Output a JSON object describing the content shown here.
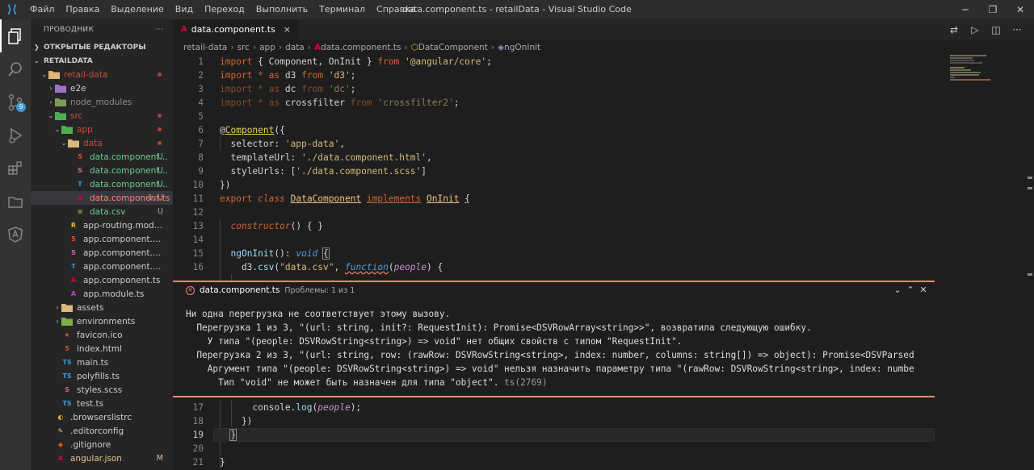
{
  "window": {
    "title": "data.component.ts - retailData - Visual Studio Code",
    "menu": [
      "Файл",
      "Правка",
      "Выделение",
      "Вид",
      "Переход",
      "Выполнить",
      "Терминал",
      "Справка"
    ]
  },
  "activitybar": {
    "items": [
      {
        "name": "explorer-icon"
      },
      {
        "name": "search-icon"
      },
      {
        "name": "source-control-icon",
        "badge": "9"
      },
      {
        "name": "run-debug-icon"
      },
      {
        "name": "extensions-icon"
      },
      {
        "name": "remote-explorer-icon"
      },
      {
        "name": "angular-icon"
      }
    ]
  },
  "sidebar": {
    "title": "ПРОВОДНИК",
    "more": "···",
    "open_editors": "ОТКРЫТЫЕ РЕДАКТОРЫ",
    "root": "RETAILDATA",
    "tree": [
      {
        "label": "retail-data",
        "depth": 1,
        "type": "folder",
        "open": true,
        "dot": true,
        "color": "#c74e39",
        "icon_color": "#dcb67a"
      },
      {
        "label": "e2e",
        "depth": 2,
        "type": "folder",
        "open": false,
        "color": "#cccccc",
        "icon_color": "#a074c4"
      },
      {
        "label": "node_modules",
        "depth": 2,
        "type": "folder",
        "open": false,
        "color": "#8c8c8c",
        "icon_color": "#7b9c59"
      },
      {
        "label": "src",
        "depth": 2,
        "type": "folder",
        "open": true,
        "dot": true,
        "color": "#c74e39",
        "icon_color": "#4caf50"
      },
      {
        "label": "app",
        "depth": 3,
        "type": "folder",
        "open": true,
        "dot": true,
        "color": "#c74e39",
        "icon_color": "#4caf50"
      },
      {
        "label": "data",
        "depth": 4,
        "type": "folder",
        "open": true,
        "dot": true,
        "color": "#c74e39",
        "icon_color": "#dcb67a"
      },
      {
        "label": "data.component.html",
        "depth": 5,
        "type": "html",
        "status": "U",
        "color": "#73c991",
        "icon": "5",
        "icon_color": "#e44d26"
      },
      {
        "label": "data.component.scss",
        "depth": 5,
        "type": "scss",
        "status": "U",
        "color": "#73c991",
        "icon": "S",
        "icon_color": "#cd6799"
      },
      {
        "label": "data.component.spec.ts",
        "depth": 5,
        "type": "spec",
        "status": "U",
        "color": "#73c991",
        "icon": "T",
        "icon_color": "#3c99d4"
      },
      {
        "label": "data.component.ts",
        "depth": 5,
        "type": "ts",
        "status": "1, U",
        "selected": true,
        "color": "#f48771",
        "icon": "A",
        "icon_color": "#dd0031"
      },
      {
        "label": "data.csv",
        "depth": 5,
        "type": "csv",
        "status": "U",
        "color": "#73c991",
        "icon": "≡",
        "icon_color": "#7fae42"
      },
      {
        "label": "app-routing.module.ts",
        "depth": 4,
        "type": "ts",
        "color": "#cccccc",
        "icon": "R",
        "icon_color": "#e6b422"
      },
      {
        "label": "app.component.html",
        "depth": 4,
        "type": "html",
        "color": "#cccccc",
        "icon": "5",
        "icon_color": "#e44d26"
      },
      {
        "label": "app.component.scss",
        "depth": 4,
        "type": "scss",
        "color": "#cccccc",
        "icon": "S",
        "icon_color": "#cd6799"
      },
      {
        "label": "app.component.spec.ts",
        "depth": 4,
        "type": "spec",
        "color": "#cccccc",
        "icon": "T",
        "icon_color": "#3c99d4"
      },
      {
        "label": "app.component.ts",
        "depth": 4,
        "type": "ts",
        "color": "#cccccc",
        "icon": "A",
        "icon_color": "#dd0031"
      },
      {
        "label": "app.module.ts",
        "depth": 4,
        "type": "ts",
        "color": "#cccccc",
        "icon": "A",
        "icon_color": "#b048c4"
      },
      {
        "label": "assets",
        "depth": 3,
        "type": "folder",
        "open": false,
        "color": "#cccccc",
        "icon_color": "#dcb67a"
      },
      {
        "label": "environments",
        "depth": 3,
        "type": "folder",
        "open": false,
        "color": "#cccccc",
        "icon_color": "#7fae42"
      },
      {
        "label": "favicon.ico",
        "depth": 3,
        "type": "ico",
        "color": "#cccccc",
        "icon": "★",
        "icon_color": "#e44d26"
      },
      {
        "label": "index.html",
        "depth": 3,
        "type": "html",
        "color": "#cccccc",
        "icon": "5",
        "icon_color": "#e44d26"
      },
      {
        "label": "main.ts",
        "depth": 3,
        "type": "ts",
        "color": "#cccccc",
        "icon": "TS",
        "icon_color": "#3c99d4"
      },
      {
        "label": "polyfills.ts",
        "depth": 3,
        "type": "ts",
        "color": "#cccccc",
        "icon": "TS",
        "icon_color": "#3c99d4"
      },
      {
        "label": "styles.scss",
        "depth": 3,
        "type": "scss",
        "color": "#cccccc",
        "icon": "S",
        "icon_color": "#cd6799"
      },
      {
        "label": "test.ts",
        "depth": 3,
        "type": "ts",
        "color": "#cccccc",
        "icon": "TS",
        "icon_color": "#3c99d4"
      },
      {
        "label": ".browserslistrc",
        "depth": 2,
        "type": "cfg",
        "color": "#cccccc",
        "icon": "◐",
        "icon_color": "#e6b422"
      },
      {
        "label": ".editorconfig",
        "depth": 2,
        "type": "cfg",
        "color": "#cccccc",
        "icon": "✎",
        "icon_color": "#cccccc"
      },
      {
        "label": ".gitignore",
        "depth": 2,
        "type": "cfg",
        "color": "#cccccc",
        "icon": "◆",
        "icon_color": "#e44d26"
      },
      {
        "label": "angular.json",
        "depth": 2,
        "type": "json",
        "status": "M",
        "color": "#e2c08d",
        "icon": "A",
        "icon_color": "#dd0031"
      }
    ]
  },
  "editor": {
    "tab": {
      "label": "data.component.ts",
      "close": "×"
    },
    "breadcrumb": [
      "retail-data",
      "src",
      "app",
      "data",
      "data.component.ts",
      "DataComponent",
      "ngOnInit"
    ],
    "lines_top": [
      {
        "n": "1",
        "html": "<span class='kw'>import</span> { Component, OnInit } <span class='kw'>from</span> <span class='str'>'@angular/core'</span>;"
      },
      {
        "n": "2",
        "html": "<span class='kw'>import</span> <span class='kw'>*</span> <span class='kw'>as</span> d3 <span class='kw'>from</span> <span class='str'>'d3'</span>;"
      },
      {
        "n": "3",
        "html": "<span class='kw' style='opacity:.6'>import</span> <span class='kw' style='opacity:.6'>*</span> <span class='kw' style='opacity:.6'>as</span> dc <span class='kw' style='opacity:.6'>from</span> <span class='str' style='opacity:.6'>'dc'</span>;"
      },
      {
        "n": "4",
        "html": "<span class='kw' style='opacity:.6'>import</span> <span class='kw' style='opacity:.6'>*</span> <span class='kw' style='opacity:.6'>as</span> crossfilter <span class='kw' style='opacity:.6'>from</span> <span class='str' style='opacity:.6'>'crossfilter2'</span>;"
      },
      {
        "n": "5",
        "html": ""
      },
      {
        "n": "6",
        "html": "@<span class='dec'>Component</span>({"
      },
      {
        "n": "7",
        "html": "  selector: <span class='str'>'app-data'</span>,"
      },
      {
        "n": "8",
        "html": "  templateUrl: <span class='str'>'./data.component.html'</span>,"
      },
      {
        "n": "9",
        "html": "  styleUrls: [<span class='str'>'./data.component.scss'</span>]"
      },
      {
        "n": "10",
        "html": "})"
      },
      {
        "n": "11",
        "html": "<span class='kw'>export</span> <span class='kwi'>class</span> <span class='cls' style='text-decoration:underline'>DataComponent</span> <span class='kw' style='text-decoration:underline'>implements</span> <span class='cls' style='text-decoration:underline'>OnInit</span> <span style='text-decoration:underline'>{</span>"
      },
      {
        "n": "12",
        "html": ""
      },
      {
        "n": "13",
        "html": "  <span class='kwi'>constructor</span>() { }"
      },
      {
        "n": "14",
        "html": ""
      },
      {
        "n": "15",
        "html": "  <span class='fn'>ngOnInit</span>(): <span class='typ'>void</span> <span style='outline:1px solid #888'>{</span>"
      },
      {
        "n": "16",
        "html": "    d3.<span class='fn'>csv</span>(<span class='str'>\"data.csv\"</span>, <span class='kwb' style='text-decoration:underline wavy #f48771'>function</span>(<span class='par'>people</span>) {"
      }
    ],
    "lines_bottom": [
      {
        "n": "17",
        "html": "      console.<span class='fn'>log</span>(<span class='par'>people</span>);"
      },
      {
        "n": "18",
        "html": "    })"
      },
      {
        "n": "19",
        "html": "  <span style='outline:1px solid #888'>}</span>",
        "current": true
      },
      {
        "n": "20",
        "html": ""
      },
      {
        "n": "21",
        "html": "}"
      }
    ]
  },
  "problems": {
    "file": "data.component.ts",
    "count": "Проблемы: 1 из 1",
    "lines": [
      "Ни одна перегрузка не соответствует этому вызову.",
      "  Перегрузка 1 из 3, \"(url: string, init?: RequestInit): Promise<DSVRowArray<string>>\", возвратила следующую ошибку.",
      "    У типа \"(people: DSVRowString<string>) => void\" нет общих свойств с типом \"RequestInit\".",
      "  Перегрузка 2 из 3, \"(url: string, row: (rawRow: DSVRowString<string>, index: number, columns: string[]) => object): Promise<DSVParsed",
      "    Аргумент типа \"(people: DSVRowString<string>) => void\" нельзя назначить параметру типа \"(rawRow: DSVRowString<string>, index: numbe",
      "      Тип \"void\" не может быть назначен для типа \"object\"."
    ],
    "code": "ts(2769)"
  }
}
